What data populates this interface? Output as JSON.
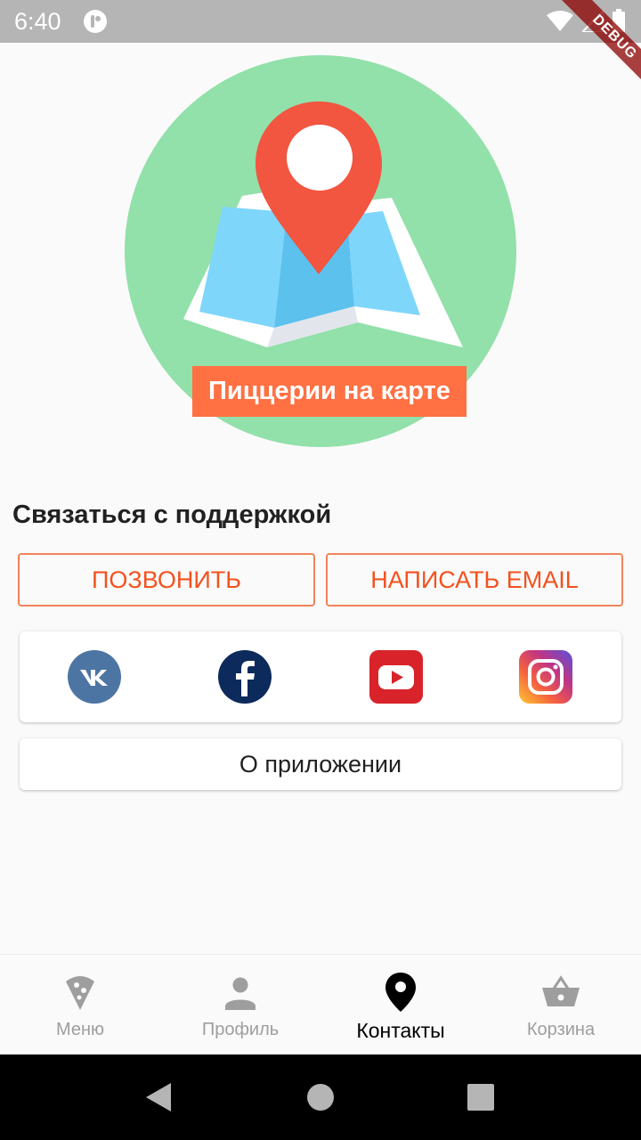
{
  "status_bar": {
    "time": "6:40",
    "debug_label": "DEBUG"
  },
  "map_banner": {
    "label": "Пиццерии на карте"
  },
  "support": {
    "heading": "Связаться с поддержкой",
    "call_label": "ПОЗВОНИТЬ",
    "email_label": "НАПИСАТЬ EMAIL"
  },
  "social": {
    "items": [
      {
        "icon": "vk-icon"
      },
      {
        "icon": "facebook-icon"
      },
      {
        "icon": "youtube-icon"
      },
      {
        "icon": "instagram-icon"
      }
    ]
  },
  "about": {
    "label": "О приложении"
  },
  "bottom_nav": {
    "active_index": 2,
    "items": [
      {
        "label": "Меню",
        "icon": "pizza-icon"
      },
      {
        "label": "Профиль",
        "icon": "person-icon"
      },
      {
        "label": "Контакты",
        "icon": "location-pin-icon"
      },
      {
        "label": "Корзина",
        "icon": "basket-icon"
      }
    ]
  },
  "colors": {
    "accent": "#ff7043",
    "button_text": "#f4511e",
    "map_circle": "#92e0aa",
    "pin": "#f25540"
  }
}
